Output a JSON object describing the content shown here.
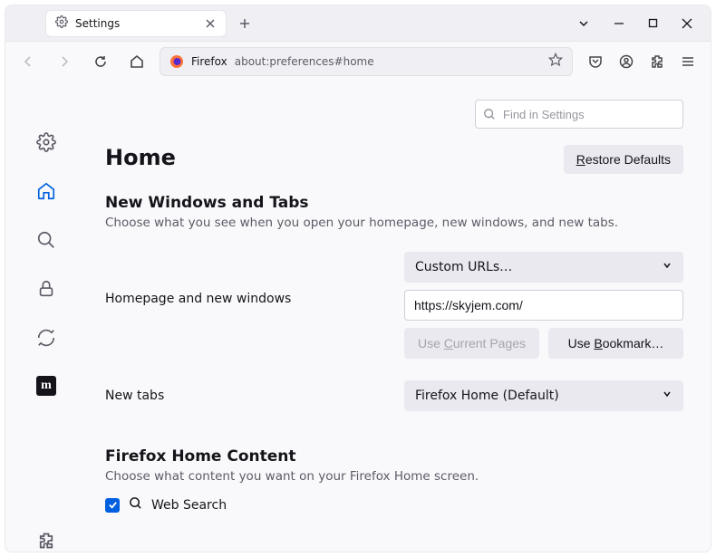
{
  "tab": {
    "title": "Settings"
  },
  "address": {
    "label": "Firefox",
    "url": "about:preferences#home"
  },
  "search": {
    "placeholder": "Find in Settings"
  },
  "page": {
    "title": "Home"
  },
  "buttons": {
    "restore_defaults_pre": "R",
    "restore_defaults_post": "estore Defaults",
    "use_current_pre": "Use ",
    "use_current_mid": "C",
    "use_current_post": "urrent Pages",
    "use_bookmark_pre": "Use ",
    "use_bookmark_mid": "B",
    "use_bookmark_post": "ookmark…"
  },
  "section_nw": {
    "heading": "New Windows and Tabs",
    "sub": "Choose what you see when you open your homepage, new windows, and new tabs."
  },
  "form": {
    "homepage_label": "Homepage and new windows",
    "homepage_dropdown": "Custom URLs…",
    "homepage_value": "https://skyjem.com/",
    "newtabs_label": "New tabs",
    "newtabs_dropdown": "Firefox Home (Default)"
  },
  "section_fhc": {
    "heading": "Firefox Home Content",
    "sub": "Choose what content you want on your Firefox Home screen.",
    "check_websearch": "Web Search"
  }
}
